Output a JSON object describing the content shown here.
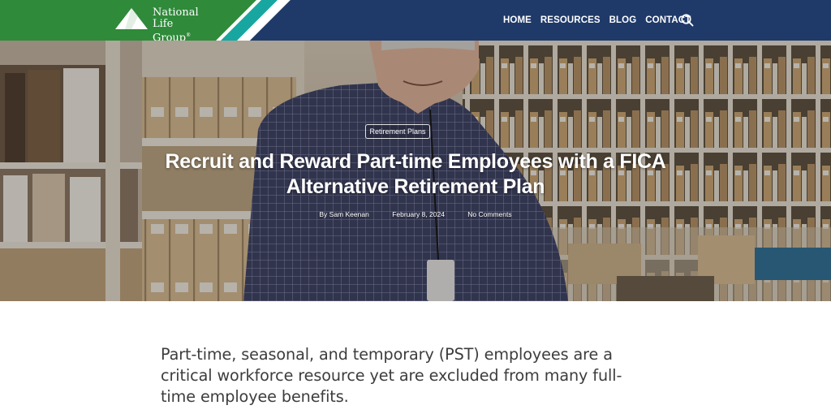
{
  "header": {
    "logo": {
      "line1": "National Life",
      "line2": "Group",
      "reg": "®"
    },
    "nav": [
      "HOME",
      "RESOURCES",
      "BLOG",
      "CONTACT"
    ],
    "search_icon": "search-icon",
    "colors": {
      "navy": "#1f3a69",
      "green": "#2f8a3a",
      "teal": "#17a7a0"
    }
  },
  "hero": {
    "category": "Retirement Plans",
    "title": "Recruit and Reward Part-time Employees with a FICA Alternative Retirement Plan",
    "author": "By Sam Keenan",
    "date": "February 8, 2024",
    "comments": "No Comments"
  },
  "article": {
    "lede": "Part-time, seasonal, and temporary (PST) employees are a critical workforce resource yet are excluded from many full-time employee benefits."
  }
}
